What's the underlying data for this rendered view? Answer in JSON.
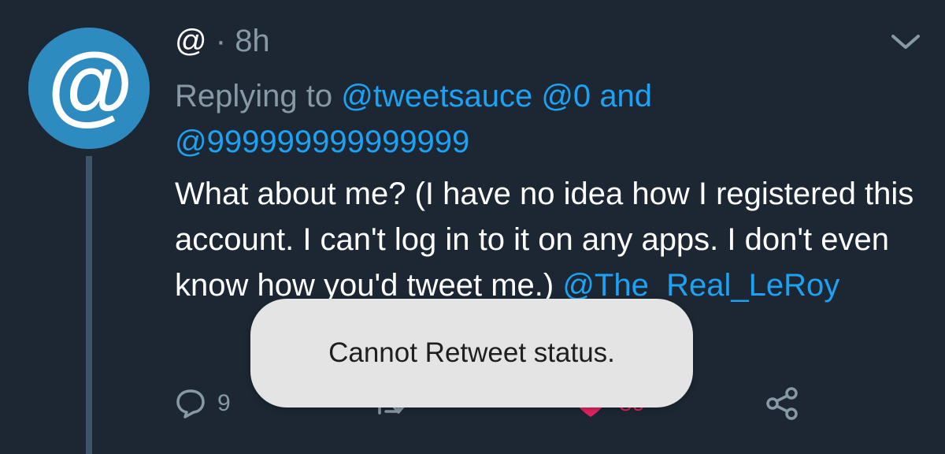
{
  "tweet": {
    "handle": "@",
    "separator": "·",
    "time": "8h",
    "avatar_symbol": "@",
    "replying_prefix": "Replying to",
    "replying_mentions": [
      "@tweetsauce",
      "@0",
      "@999999999999999"
    ],
    "replying_and": "and",
    "body_text": "What about me? (I have no idea how I registered this account. I can't log in to it on any apps. I don't even know how you'd tweet me.)",
    "body_mention": "@The_Real_LeRoy",
    "actions": {
      "reply_count": "9",
      "like_count": "89",
      "reply_icon": "reply-icon",
      "retweet_icon": "retweet-icon",
      "like_icon": "heart-icon",
      "share_icon": "share-icon"
    }
  },
  "toast": {
    "message": "Cannot Retweet status."
  },
  "colors": {
    "background": "#1c2733",
    "accent": "#1da1f2",
    "muted": "#8899a6",
    "like": "#e0245e",
    "avatar": "#2e8bc0",
    "toast_bg": "#e4e4e4"
  }
}
